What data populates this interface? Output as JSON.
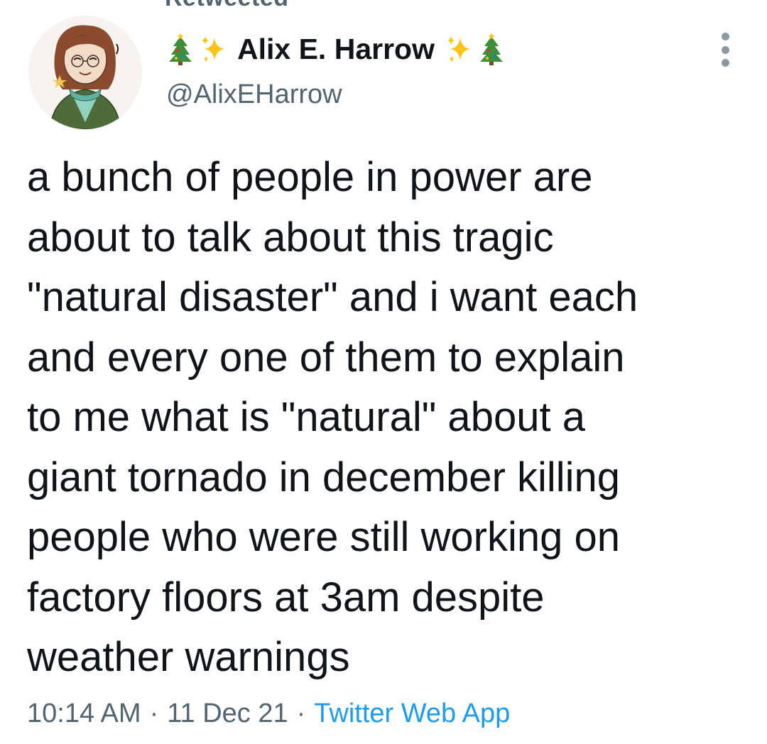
{
  "header": {
    "retweeted_label": "Retweeted"
  },
  "author": {
    "avatar_icon": "illustrated-portrait-avatar",
    "display_name": "Alix E. Harrow",
    "name_emoji_left": [
      "christmas-tree-icon",
      "sparkles-icon"
    ],
    "name_emoji_right": [
      "sparkles-icon",
      "christmas-tree-icon"
    ],
    "handle": "@AlixEHarrow"
  },
  "tweet": {
    "text_lines": [
      "a bunch of people in power are",
      "about to talk about this tragic",
      "\"natural disaster\" and i want each",
      "and every one of them to explain",
      "to me what is \"natural\" about a",
      "giant tornado in december killing",
      "people who were still working on",
      "factory floors at 3am despite",
      "weather warnings"
    ]
  },
  "meta": {
    "time": "10:14 AM",
    "separator": "·",
    "date": "11 Dec 21",
    "source": "Twitter Web App"
  },
  "colors": {
    "text_primary": "#0f1419",
    "text_secondary": "#536471",
    "link": "#1d9bf0",
    "tree_green": "#3f8f3a",
    "sparkle_yellow": "#fcc419"
  }
}
